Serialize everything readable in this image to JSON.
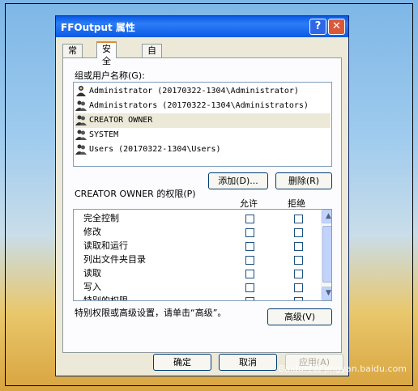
{
  "window": {
    "title": "FFOutput 属性",
    "help_label": "?",
    "close_label": "✕"
  },
  "tabs": [
    {
      "label": "常规"
    },
    {
      "label": "安全"
    },
    {
      "label": "自定义"
    }
  ],
  "security": {
    "users_label": "组或用户名称(G):",
    "users": [
      {
        "name": "Administrator (20170322-1304\\Administrator)"
      },
      {
        "name": "Administrators (20170322-1304\\Administrators)"
      },
      {
        "name": "CREATOR OWNER"
      },
      {
        "name": "SYSTEM"
      },
      {
        "name": "Users (20170322-1304\\Users)"
      }
    ],
    "add_label": "添加(D)...",
    "remove_label": "删除(R)",
    "permissions_label": "CREATOR OWNER 的权限(P)",
    "allow_header": "允许",
    "deny_header": "拒绝",
    "permissions": [
      {
        "name": "完全控制"
      },
      {
        "name": "修改"
      },
      {
        "name": "读取和运行"
      },
      {
        "name": "列出文件夹目录"
      },
      {
        "name": "读取"
      },
      {
        "name": "写入"
      },
      {
        "name": "特别的权限"
      }
    ],
    "advanced_hint": "特别权限或高级设置，请单击“高级”。",
    "advanced_label": "高级(V)"
  },
  "footer": {
    "ok_label": "确定",
    "cancel_label": "取消",
    "apply_label": "应用(A)"
  },
  "watermark": "Baidu经验 jingyan.baidu.com"
}
